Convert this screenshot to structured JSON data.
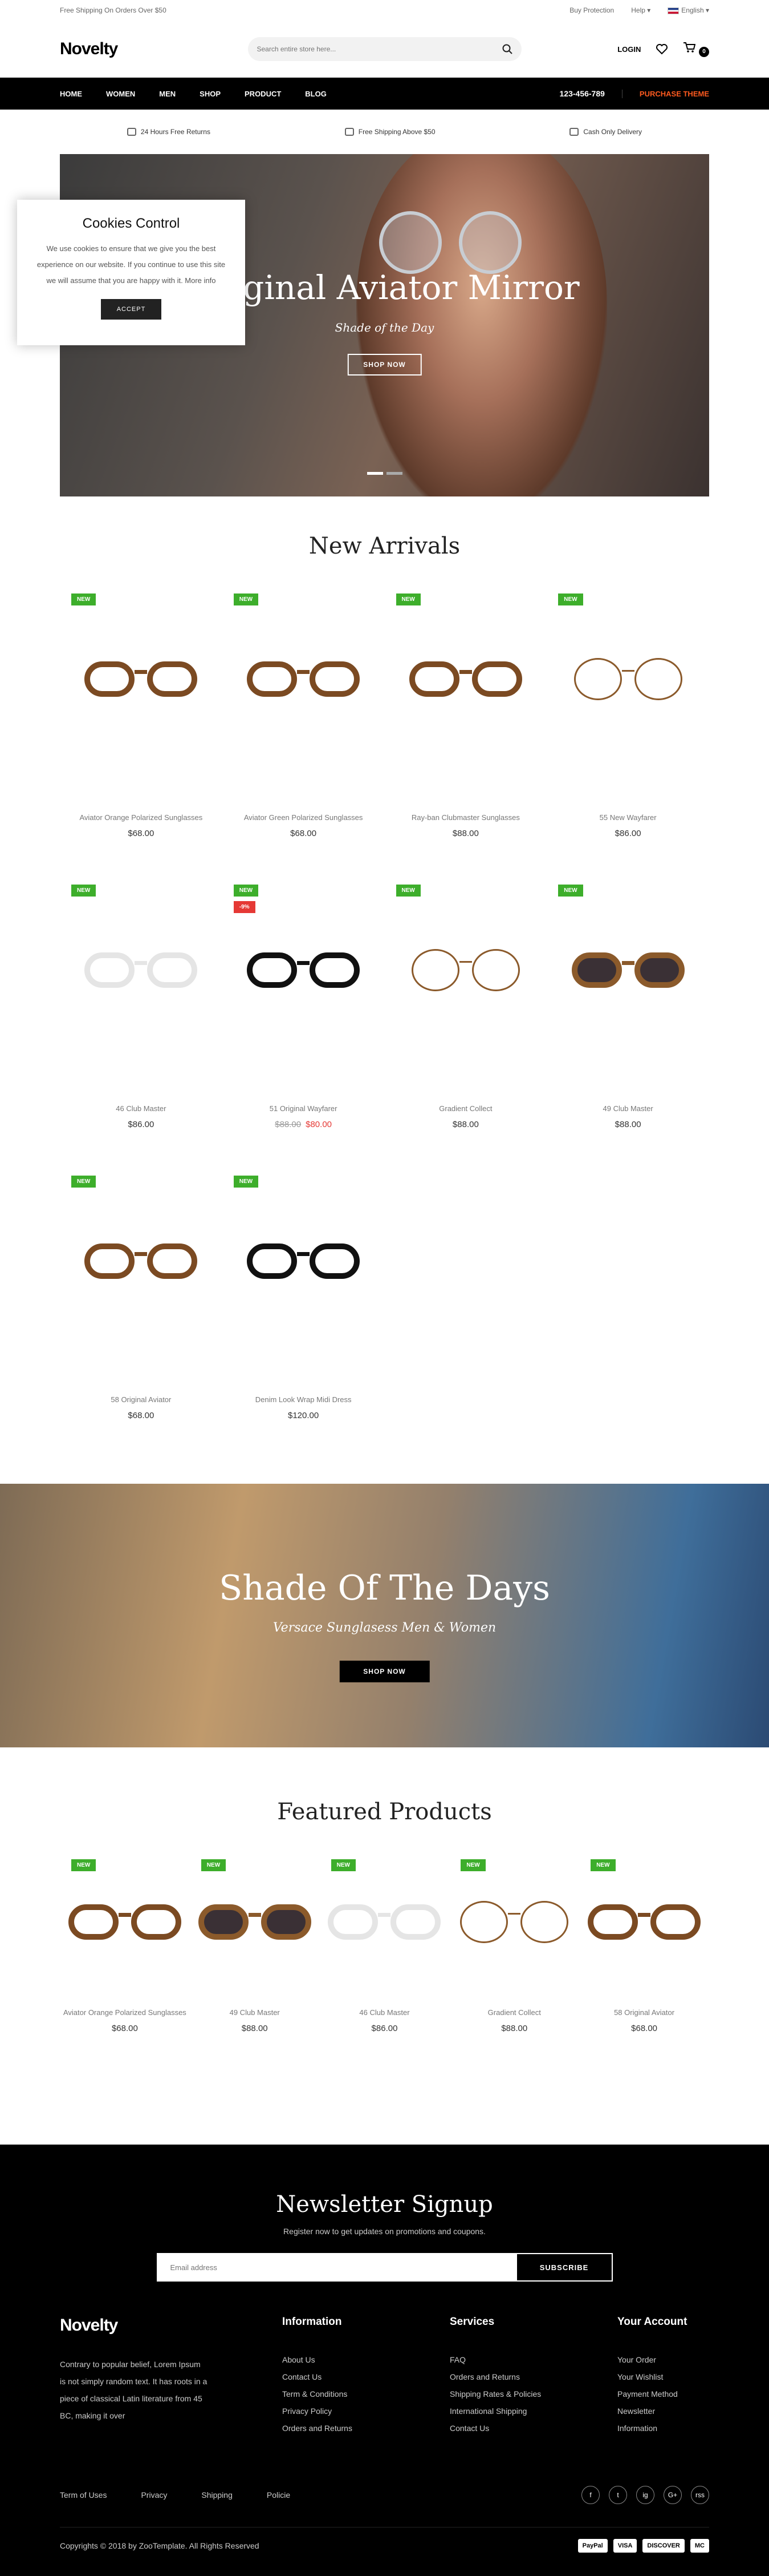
{
  "topbar": {
    "left": "Free Shipping On Orders Over $50",
    "protection": "Buy Protection",
    "help": "Help",
    "language": "English"
  },
  "header": {
    "logo": "Novelty",
    "search_placeholder": "Search entire store here...",
    "login": "LOGIN",
    "cart_count": "0"
  },
  "nav": {
    "items": [
      "HOME",
      "WOMEN",
      "MEN",
      "SHOP",
      "PRODUCT",
      "BLOG"
    ],
    "phone": "123-456-789",
    "purchase": "PURCHASE THEME",
    "accent": "#ff5a1f"
  },
  "features": [
    "24 Hours Free Returns",
    "Free Shipping Above $50",
    "Cash Only Delivery"
  ],
  "hero": {
    "title": "Original Aviator Mirror",
    "subtitle": "Shade of the Day",
    "button": "SHOP NOW"
  },
  "cookie": {
    "title": "Cookies Control",
    "text": "We use cookies to ensure that we give you the best experience on our website. If you continue to use this site we will assume that you are happy with it. More info",
    "button": "ACCEPT"
  },
  "new_arrivals": {
    "title": "New Arrivals",
    "products": [
      {
        "badge": "NEW",
        "name": "Aviator Orange Polarized Sunglasses",
        "price": "$68.00",
        "style": "tort"
      },
      {
        "badge": "NEW",
        "name": "Aviator Green Polarized Sunglasses",
        "price": "$68.00",
        "style": "tort"
      },
      {
        "badge": "NEW",
        "name": "Ray-ban Clubmaster Sunglasses",
        "price": "$88.00",
        "style": "tort"
      },
      {
        "badge": "NEW",
        "name": "55 New Wayfarer",
        "price": "$86.00",
        "style": "thin"
      },
      {
        "badge": "NEW",
        "name": "46 Club Master",
        "price": "$86.00",
        "style": "clear"
      },
      {
        "badge": "NEW",
        "sale": "-9%",
        "name": "51 Original Wayfarer",
        "old_price": "$88.00",
        "price": "$80.00",
        "style": "black"
      },
      {
        "badge": "NEW",
        "name": "Gradient Collect",
        "price": "$88.00",
        "style": "thin"
      },
      {
        "badge": "NEW",
        "name": "49 Club Master",
        "price": "$88.00",
        "style": "sun"
      },
      {
        "badge": "NEW",
        "name": "58 Original Aviator",
        "price": "$68.00",
        "style": "tort"
      },
      {
        "badge": "NEW",
        "name": "Denim Look Wrap Midi Dress",
        "price": "$120.00",
        "style": "black"
      }
    ]
  },
  "banner": {
    "title": "Shade Of The Days",
    "subtitle": "Versace Sunglasess Men & Women",
    "button": "SHOP NOW"
  },
  "featured": {
    "title": "Featured Products",
    "products": [
      {
        "badge": "NEW",
        "name": "Aviator Orange Polarized Sunglasses",
        "price": "$68.00",
        "style": "tort"
      },
      {
        "badge": "NEW",
        "name": "49 Club Master",
        "price": "$88.00",
        "style": "sun"
      },
      {
        "badge": "NEW",
        "name": "46 Club Master",
        "price": "$86.00",
        "style": "clear"
      },
      {
        "badge": "NEW",
        "name": "Gradient Collect",
        "price": "$88.00",
        "style": "thin"
      },
      {
        "badge": "NEW",
        "name": "58 Original Aviator",
        "price": "$68.00",
        "style": "tort"
      }
    ]
  },
  "newsletter": {
    "title": "Newsletter Signup",
    "subtitle": "Register now to get updates on promotions and coupons.",
    "placeholder": "Email address",
    "button": "SUBSCRIBE"
  },
  "footer": {
    "logo": "Novelty",
    "about": "Contrary to popular belief, Lorem Ipsum is not simply random text. It has roots in a piece of classical Latin literature from 45 BC, making it over",
    "info_title": "Information",
    "info": [
      "About Us",
      "Contact Us",
      "Term & Conditions",
      "Privacy Policy",
      "Orders and Returns"
    ],
    "services_title": "Services",
    "services": [
      "FAQ",
      "Orders and Returns",
      "Shipping Rates & Policies",
      "International Shipping",
      "Contact Us"
    ],
    "account_title": "Your Account",
    "account": [
      "Your Order",
      "Your Wishlist",
      "Payment Method",
      "Newsletter",
      "Information"
    ],
    "bottom_links": [
      "Term of Uses",
      "Privacy",
      "Shipping",
      "Policie"
    ],
    "social": [
      "f",
      "t",
      "ig",
      "G+",
      "rss"
    ],
    "copyright": "Copyrights © 2018 by ZooTemplate. All Rights Reserved",
    "payments": [
      "PayPal",
      "VISA",
      "DISCOVER",
      "MC"
    ]
  }
}
